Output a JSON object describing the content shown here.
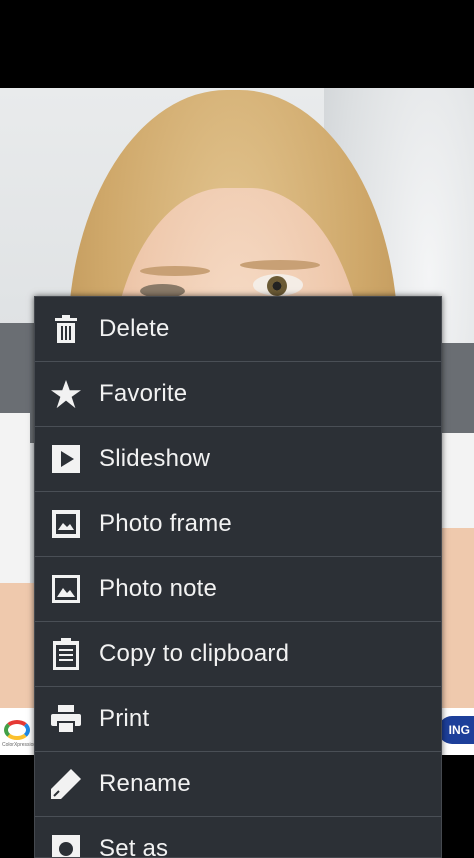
{
  "photo": {
    "description_icon": "photo-image"
  },
  "ad_strip": {
    "left_logo_text": "ColorXpressions",
    "right_logo_text": "ING"
  },
  "menu": {
    "items": [
      {
        "label": "Delete",
        "icon": "trash-icon"
      },
      {
        "label": "Favorite",
        "icon": "star-icon"
      },
      {
        "label": "Slideshow",
        "icon": "play-icon"
      },
      {
        "label": "Photo frame",
        "icon": "photo-frame-icon"
      },
      {
        "label": "Photo note",
        "icon": "photo-note-icon"
      },
      {
        "label": "Copy to clipboard",
        "icon": "clipboard-icon"
      },
      {
        "label": "Print",
        "icon": "printer-icon"
      },
      {
        "label": "Rename",
        "icon": "pencil-icon"
      },
      {
        "label": "Set as",
        "icon": "set-as-icon"
      }
    ]
  },
  "colors": {
    "menu_bg": "#2c3036",
    "divider": "#4a4f56",
    "text": "#f2f2f2"
  }
}
